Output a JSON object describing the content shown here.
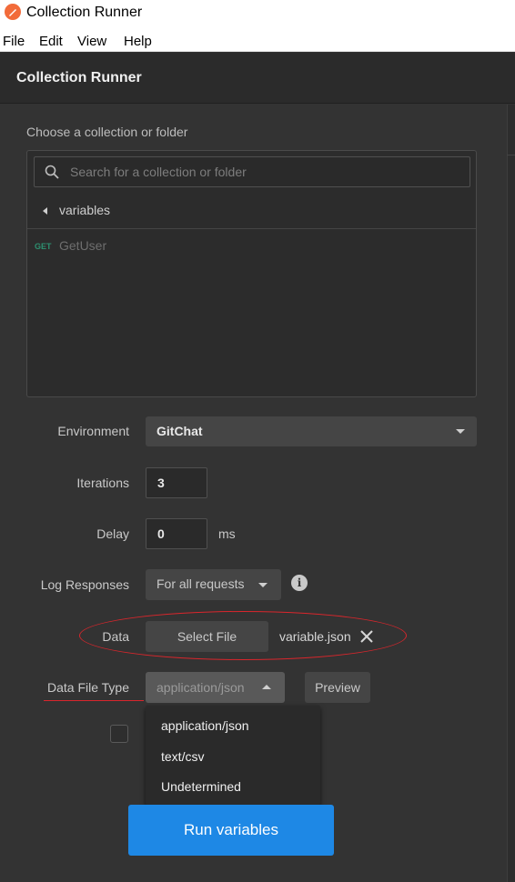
{
  "window": {
    "title": "Collection Runner",
    "icon": "postman-icon"
  },
  "menu": [
    "File",
    "Edit",
    "View",
    "Help"
  ],
  "header": {
    "title": "Collection Runner"
  },
  "collection": {
    "label": "Choose a collection or folder",
    "search_placeholder": "Search for a collection or folder",
    "folder": "variables",
    "requests": [
      {
        "method": "GET",
        "name": "GetUser"
      }
    ]
  },
  "form": {
    "environment": {
      "label": "Environment",
      "value": "GitChat"
    },
    "iterations": {
      "label": "Iterations",
      "value": "3"
    },
    "delay": {
      "label": "Delay",
      "value": "0",
      "unit": "ms"
    },
    "log_responses": {
      "label": "Log Responses",
      "value": "For all requests"
    },
    "data": {
      "label": "Data",
      "button": "Select File",
      "file": "variable.json"
    },
    "data_file_type": {
      "label": "Data File Type",
      "value": "application/json",
      "preview": "Preview",
      "options": [
        "application/json",
        "text/csv",
        "Undetermined"
      ]
    }
  },
  "run_button": "Run variables",
  "colors": {
    "accent": "#1e88e5",
    "annotation": "#d9262c",
    "get_method": "#2d8f6f",
    "app_icon": "#f26b3a"
  }
}
